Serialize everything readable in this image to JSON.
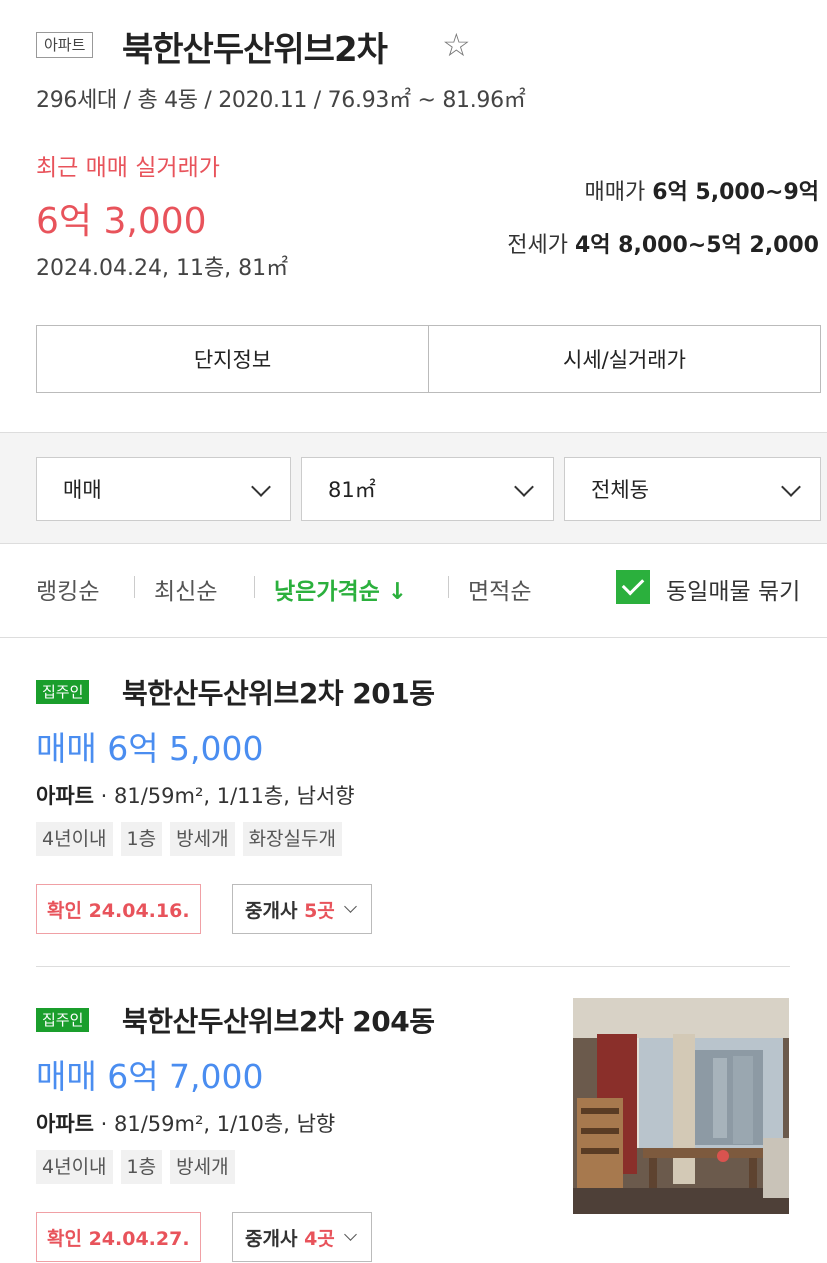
{
  "complex": {
    "type_tag": "아파트",
    "name": "북한산두산위브2차",
    "star_icon": "star-outline-icon",
    "summary": "296세대 / 총 4동 / 2020.11 / 76.93㎡ ~ 81.96㎡",
    "recent_label": "최근 매매 실거래가",
    "recent_price": "6억 3,000",
    "recent_detail": "2024.04.24, 11층, 81㎡",
    "sale_label": "매매가",
    "sale_range": "6억 5,000~9억",
    "jeonse_label": "전세가",
    "jeonse_range": "4억 8,000~5억 2,000"
  },
  "tabs": [
    "단지정보",
    "시세/실거래가"
  ],
  "filters": {
    "trade_type": "매매",
    "area": "81㎡",
    "building": "전체동"
  },
  "sort": {
    "options": [
      "랭킹순",
      "최신순",
      "낮은가격순 ↓",
      "면적순"
    ],
    "active_index": 2,
    "group_label": "동일매물 묶기",
    "group_checked": true
  },
  "listings": [
    {
      "badge": "집주인",
      "title": "북한산두산위브2차 201동",
      "price": "매매 6억 5,000",
      "type": "아파트",
      "spec": "· 81/59m², 1/11층, 남서향",
      "chips": [
        "4년이내",
        "1층",
        "방세개",
        "화장실두개"
      ],
      "confirm": "확인 24.04.16.",
      "agents_label": "중개사",
      "agents_count": "5곳"
    },
    {
      "badge": "집주인",
      "title": "북한산두산위브2차 204동",
      "price": "매매 6억 7,000",
      "type": "아파트",
      "spec": "· 81/59m², 1/10층, 남향",
      "chips": [
        "4년이내",
        "1층",
        "방세개"
      ],
      "confirm": "확인 24.04.27.",
      "agents_label": "중개사",
      "agents_count": "4곳",
      "photo": "apartment-interior-photo"
    }
  ],
  "colors": {
    "accent_red": "#e8535b",
    "price_blue": "#4a8df0",
    "active_green": "#2bb03d",
    "badge_green": "#1a9e2c"
  }
}
